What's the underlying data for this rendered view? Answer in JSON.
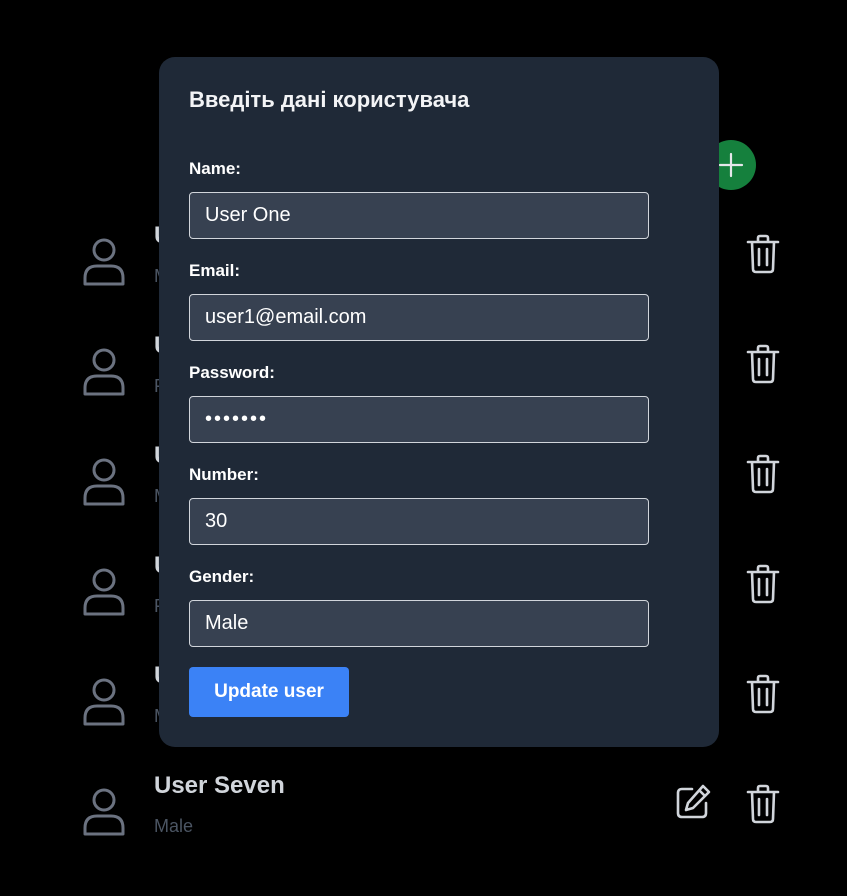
{
  "colors": {
    "background": "#000000",
    "modal_bg": "#1f2937",
    "input_bg": "#374151",
    "primary": "#3b82f6",
    "add_button": "#15803d",
    "icon_muted": "#6b7280",
    "icon_light": "#d1d5db"
  },
  "list": {
    "add_icon": "plus-icon",
    "rows": [
      {
        "name": "U",
        "gender": "M"
      },
      {
        "name": "U",
        "gender": "F"
      },
      {
        "name": "U",
        "gender": "M"
      },
      {
        "name": "U",
        "gender": "F"
      },
      {
        "name": "U",
        "gender": "M"
      },
      {
        "name": "User Seven",
        "gender": "Male"
      }
    ]
  },
  "modal": {
    "title": "Введіть дані користувача",
    "fields": {
      "name": {
        "label": "Name:",
        "value": "User One"
      },
      "email": {
        "label": "Email:",
        "value": "user1@email.com"
      },
      "password": {
        "label": "Password:",
        "value": "•••••••"
      },
      "number": {
        "label": "Number:",
        "value": "30"
      },
      "gender": {
        "label": "Gender:",
        "value": "Male"
      }
    },
    "submit_label": "Update user"
  }
}
